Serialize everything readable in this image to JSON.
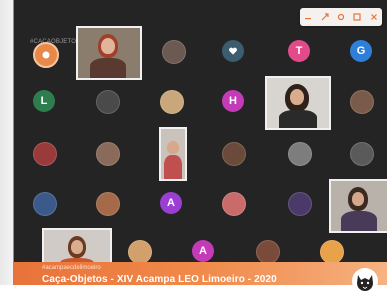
{
  "window": {
    "tile_label": "#CAÇAOBJETOS",
    "brand": "#acampaecdelimoeiro",
    "event_title": "Caça-Objetos - XIV Acampa LEO Limoeiro - 2020"
  },
  "toolbar": {
    "icons": [
      "minimize-icon",
      "expand-icon",
      "settings-icon",
      "fullscreen-icon",
      "close-icon"
    ]
  },
  "participants": [
    {
      "initial": "",
      "color": "#e8894a"
    },
    {
      "initial": "",
      "color": "#6b5a52"
    },
    {
      "initial": "",
      "color": "#3b5d6e"
    },
    {
      "initial": "T",
      "color": "#e24a8a"
    },
    {
      "initial": "G",
      "color": "#2f7fd8"
    },
    {
      "initial": "L",
      "color": "#2e7d4f"
    },
    {
      "initial": "",
      "color": "#4a4a4a"
    },
    {
      "initial": "",
      "color": "#c9a77a"
    },
    {
      "initial": "H",
      "color": "#c43bb8"
    },
    {
      "initial": "",
      "color": "#7a5a4a"
    },
    {
      "initial": "",
      "color": "#9a3b3b"
    },
    {
      "initial": "",
      "color": "#8a6a5a"
    },
    {
      "initial": "",
      "color": "#6a4a3a"
    },
    {
      "initial": "",
      "color": "#7d7d7d"
    },
    {
      "initial": "",
      "color": "#5a5a5a"
    },
    {
      "initial": "",
      "color": "#3b5a8a"
    },
    {
      "initial": "",
      "color": "#a46a4a"
    },
    {
      "initial": "A",
      "color": "#9b3fd2"
    },
    {
      "initial": "",
      "color": "#c96b6b"
    },
    {
      "initial": "",
      "color": "#4a3a6a"
    },
    {
      "initial": "",
      "color": "#d2a06a"
    },
    {
      "initial": "",
      "color": "#7a4a3a"
    },
    {
      "initial": "A",
      "color": "#c43bb8"
    },
    {
      "initial": "",
      "color": "#6a6a6a"
    },
    {
      "initial": "",
      "color": "#e8a24a"
    }
  ],
  "credits": [
    "",
    ""
  ]
}
